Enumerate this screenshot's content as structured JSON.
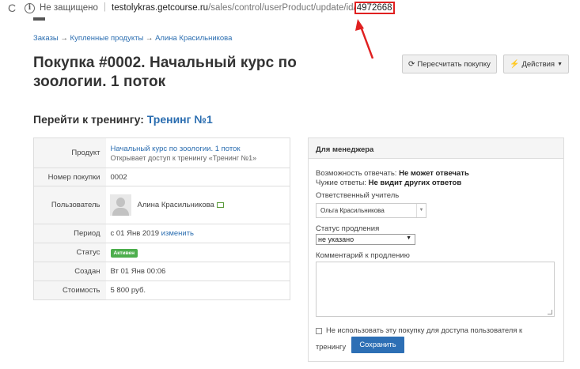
{
  "browser": {
    "not_secure": "Не защищено",
    "url_host": "testolykras.getcourse.ru",
    "url_path": "/sales/control/userProduct/update/id/",
    "url_id": "4972668"
  },
  "breadcrumb": [
    "Заказы",
    "Купленные продукты",
    "Алина Красильникова"
  ],
  "breadcrumb_sep": "→",
  "page_title": "Покупка #0002. Начальный курс по зоологии. 1 поток",
  "buttons": {
    "recalc": "Пересчитать покупку",
    "actions": "Действия"
  },
  "training": {
    "label": "Перейти к тренингу:",
    "link": "Тренинг №1"
  },
  "info": {
    "product_label": "Продукт",
    "product_name": "Начальный курс по зоологии. 1 поток",
    "product_sub": "Открывает доступ к тренингу «Тренинг №1»",
    "number_label": "Номер покупки",
    "number_value": "0002",
    "user_label": "Пользователь",
    "user_name": "Алина Красильникова",
    "period_label": "Период",
    "period_value": "с 01 Янв 2019",
    "period_change": "изменить",
    "status_label": "Статус",
    "status_value": "Активен",
    "created_label": "Создан",
    "created_value": "Вт 01 Янв 00:06",
    "cost_label": "Стоимость",
    "cost_value": "5 800 руб."
  },
  "manager": {
    "title": "Для менеджера",
    "can_answer_label": "Возможность отвечать:",
    "can_answer_value": "Не может отвечать",
    "others_label": "Чужие ответы:",
    "others_value": "Не видит других ответов",
    "teacher_label": "Ответственный учитель",
    "teacher_value": "Ольга Красильникова",
    "extension_label": "Статус продления",
    "extension_value": "не указано",
    "comment_label": "Комментарий к продлению",
    "checkbox_label_1": "Не использовать эту покупку для доступа пользователя к",
    "checkbox_label_2": "тренингу",
    "save": "Сохранить"
  }
}
